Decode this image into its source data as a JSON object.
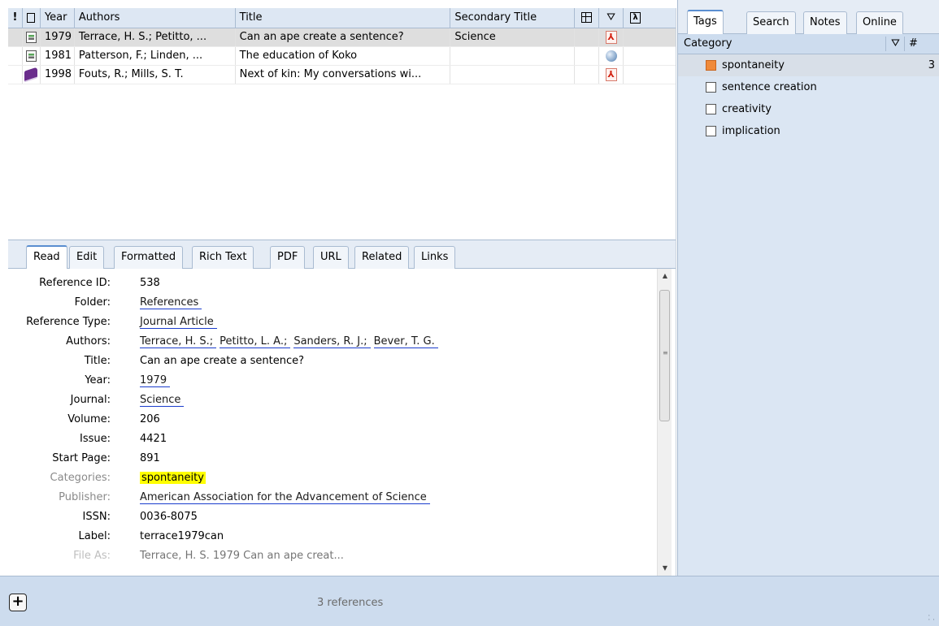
{
  "reference_list": {
    "columns": {
      "flag": "!",
      "year": "Year",
      "authors": "Authors",
      "title": "Title",
      "secondary_title": "Secondary Title"
    },
    "rows": [
      {
        "type_icon": "journal-article-icon",
        "year": "1979",
        "authors": "Terrace, H. S.; Petitto, ...",
        "title": "Can an ape create a sentence?",
        "secondary_title": "Science",
        "attachment_icon": "pdf-icon",
        "selected": true
      },
      {
        "type_icon": "journal-article-icon",
        "year": "1981",
        "authors": "Patterson, F.; Linden, ...",
        "title": "The education of Koko",
        "secondary_title": "",
        "attachment_icon": "web-link-icon",
        "selected": false
      },
      {
        "type_icon": "book-icon",
        "year": "1998",
        "authors": "Fouts, R.; Mills, S. T.",
        "title": "Next of kin: My conversations wi...",
        "secondary_title": "",
        "attachment_icon": "pdf-icon",
        "selected": false
      }
    ]
  },
  "detail_tabs": [
    "Read",
    "Edit",
    "Formatted",
    "Rich Text",
    "PDF",
    "URL",
    "Related",
    "Links"
  ],
  "detail": {
    "reference_id": {
      "label": "Reference ID:",
      "value": "538"
    },
    "folder": {
      "label": "Folder:",
      "value": "References"
    },
    "reference_type": {
      "label": "Reference Type:",
      "value": "Journal Article"
    },
    "authors": {
      "label": "Authors:",
      "values": [
        "Terrace, H. S.;",
        "Petitto, L. A.;",
        "Sanders, R. J.;",
        "Bever, T. G."
      ]
    },
    "title": {
      "label": "Title:",
      "value": "Can an ape create a sentence?"
    },
    "year": {
      "label": "Year:",
      "value": "1979"
    },
    "journal": {
      "label": "Journal:",
      "value": "Science"
    },
    "volume": {
      "label": "Volume:",
      "value": "206"
    },
    "issue": {
      "label": "Issue:",
      "value": "4421"
    },
    "start_page": {
      "label": "Start Page:",
      "value": "891"
    },
    "categories": {
      "label": "Categories:",
      "value": "spontaneity"
    },
    "publisher": {
      "label": "Publisher:",
      "value": "American Association for the Advancement of Science"
    },
    "issn": {
      "label": "ISSN:",
      "value": "0036-8075"
    },
    "label": {
      "label": "Label:",
      "value": "terrace1979can"
    },
    "file_as": {
      "label": "File As:",
      "value": "Terrace, H. S. 1979 Can an ape creat..."
    }
  },
  "side_tabs": [
    "Tags",
    "Search",
    "Notes",
    "Online"
  ],
  "categories_panel": {
    "header": "Category",
    "count_header": "#",
    "items": [
      {
        "name": "spontaneity",
        "checked": true,
        "count": "3"
      },
      {
        "name": "sentence creation",
        "checked": false,
        "count": ""
      },
      {
        "name": "creativity",
        "checked": false,
        "count": ""
      },
      {
        "name": "implication",
        "checked": false,
        "count": ""
      }
    ]
  },
  "status": {
    "add_label": "+",
    "reference_count": "3 references"
  },
  "colors": {
    "highlight": "#ffff00",
    "category_checked": "#f08a3a",
    "panel_bg": "#dbe6f3",
    "link_underline": "#1a3ccc"
  }
}
